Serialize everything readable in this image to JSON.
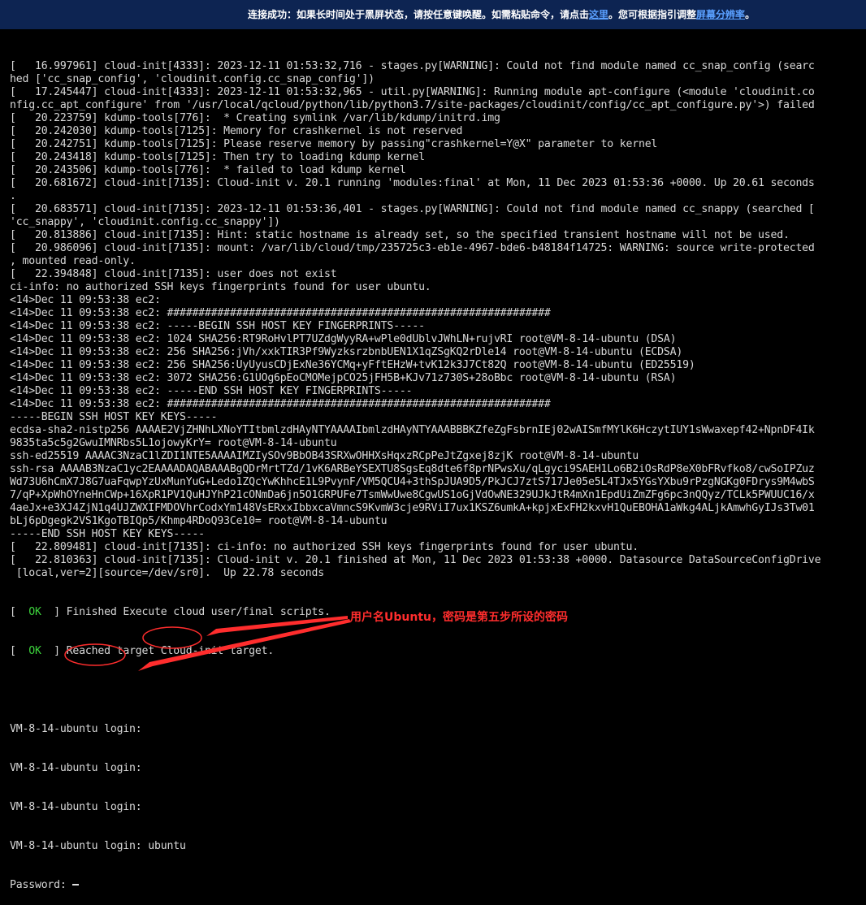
{
  "banner": {
    "prefix": "连接成功：如果长时间处于黑屏状态，请按任意键唤醒。如需粘贴命令，请点击",
    "link1": "这里",
    "middle": "。您可根据指引调整",
    "link2": "屏幕分辨率",
    "suffix": "。"
  },
  "console": {
    "lines": [
      "[   16.997961] cloud-init[4333]: 2023-12-11 01:53:32,716 - stages.py[WARNING]: Could not find module named cc_snap_config (searc",
      "hed ['cc_snap_config', 'cloudinit.config.cc_snap_config'])",
      "[   17.245447] cloud-init[4333]: 2023-12-11 01:53:32,965 - util.py[WARNING]: Running module apt-configure (<module 'cloudinit.co",
      "nfig.cc_apt_configure' from '/usr/local/qcloud/python/lib/python3.7/site-packages/cloudinit/config/cc_apt_configure.py'>) failed",
      "[   20.223759] kdump-tools[776]:  * Creating symlink /var/lib/kdump/initrd.img",
      "[   20.242030] kdump-tools[7125]: Memory for crashkernel is not reserved",
      "[   20.242751] kdump-tools[7125]: Please reserve memory by passing\"crashkernel=Y@X\" parameter to kernel",
      "[   20.243418] kdump-tools[7125]: Then try to loading kdump kernel",
      "[   20.243506] kdump-tools[776]:  * failed to load kdump kernel",
      "[   20.681672] cloud-init[7135]: Cloud-init v. 20.1 running 'modules:final' at Mon, 11 Dec 2023 01:53:36 +0000. Up 20.61 seconds",
      ".",
      "[   20.683571] cloud-init[7135]: 2023-12-11 01:53:36,401 - stages.py[WARNING]: Could not find module named cc_snappy (searched [",
      "'cc_snappy', 'cloudinit.config.cc_snappy'])",
      "[   20.813886] cloud-init[7135]: Hint: static hostname is already set, so the specified transient hostname will not be used.",
      "[   20.986096] cloud-init[7135]: mount: /var/lib/cloud/tmp/235725c3-eb1e-4967-bde6-b48184f14725: WARNING: source write-protected",
      ", mounted read-only.",
      "[   22.394848] cloud-init[7135]: user does not exist",
      "ci-info: no authorized SSH keys fingerprints found for user ubuntu.",
      "<14>Dec 11 09:53:38 ec2:",
      "<14>Dec 11 09:53:38 ec2: #############################################################",
      "<14>Dec 11 09:53:38 ec2: -----BEGIN SSH HOST KEY FINGERPRINTS-----",
      "<14>Dec 11 09:53:38 ec2: 1024 SHA256:RT9RoHvlPT7UZdgWyyRA+wPle0dUblvJWhLN+rujvRI root@VM-8-14-ubuntu (DSA)",
      "<14>Dec 11 09:53:38 ec2: 256 SHA256:jVh/xxkTIR3Pf9WyzksrzbnbUEN1X1qZSgKQ2rDle14 root@VM-8-14-ubuntu (ECDSA)",
      "<14>Dec 11 09:53:38 ec2: 256 SHA256:UyUyusCDjExNe36YCMq+yFftEHzW+tvK12k3J7Ct82Q root@VM-8-14-ubuntu (ED25519)",
      "<14>Dec 11 09:53:38 ec2: 3072 SHA256:G1UOg6pEoCMOMejpCO25jFH5B+KJv71z730S+28oBbc root@VM-8-14-ubuntu (RSA)",
      "<14>Dec 11 09:53:38 ec2: -----END SSH HOST KEY FINGERPRINTS-----",
      "<14>Dec 11 09:53:38 ec2: #############################################################",
      "-----BEGIN SSH HOST KEY KEYS-----",
      "ecdsa-sha2-nistp256 AAAAE2VjZHNhLXNoYTItbmlzdHAyNTYAAAAIbmlzdHAyNTYAAABBBKZfeZgFsbrnIEj02wAISmfMYlK6HczytIUY1sWwaxepf42+NpnDF4Ik",
      "9835ta5c5g2GwuIMNRbs5L1ojowyKrY= root@VM-8-14-ubuntu",
      "ssh-ed25519 AAAAC3NzaC1lZDI1NTE5AAAAIMZIySOv9BbOB43SRXwOHHXsHqxzRCpPeJtZgxej8zjK root@VM-8-14-ubuntu",
      "ssh-rsa AAAAB3NzaC1yc2EAAAADAQABAAABgQDrMrtTZd/1vK6ARBeYSEXTU8SgsEq8dte6f8prNPwsXu/qLgyci9SAEH1Lo6B2iOsRdP8eX0bFRvfko8/cwSoIPZuz",
      "Wd73U6hCmX7J8G7uaFqwpYzUxMunYuG+Ledo1ZQcYwKhhcE1L9PvynF/VM5QCU4+3thSpJUA9D5/PkJCJ7ztS717Je05e5L4TJx5YGsYXbu9rPzgNGKg0FDrys9M4wbS",
      "7/qP+XpWhOYneHnCWp+16XpR1PV1QuHJYhP21cONmDa6jn5O1GRPUFe7TsmWwUwe8CgwUS1oGjVdOwNE329UJkJtR4mXn1EpdUiZmZFg6pc3nQQyz/TCLk5PWUUC16/x",
      "4aeJx+e3XJ4ZjN1q4UJZWXIFMDOVhrCodxYm148VsERxxIbbxcaVmncS9KvmW3cje9RViI7ux1KSZ6umkA+kpjxExFH2kxvH1QuEBOHA1aWkg4ALjkAmwhGyIJs3Tw01",
      "bLj6pDgegk2VS1KgoTBIQp5/Khmp4RDoQ93Ce10= root@VM-8-14-ubuntu",
      "-----END SSH HOST KEY KEYS-----",
      "[   22.809481] cloud-init[7135]: ci-info: no authorized SSH keys fingerprints found for user ubuntu.",
      "[   22.810363] cloud-init[7135]: Cloud-init v. 20.1 finished at Mon, 11 Dec 2023 01:53:38 +0000. Datasource DataSourceConfigDrive",
      " [local,ver=2][source=/dev/sr0].  Up 22.78 seconds"
    ],
    "ok_lines": [
      {
        "status": "OK",
        "text": "Finished Execute cloud user/final scripts."
      },
      {
        "status": "OK",
        "text": "Reached target Cloud-init target."
      }
    ],
    "login_prompts": [
      "VM-8-14-ubuntu login:",
      "VM-8-14-ubuntu login:",
      "VM-8-14-ubuntu login:"
    ],
    "login_prompt_active": "VM-8-14-ubuntu login:",
    "username": "ubuntu",
    "password_label": "Password:"
  },
  "annotation": {
    "text": "用户名Ubuntu，密码是第五步所设的密码",
    "color": "#ff2d2d"
  }
}
